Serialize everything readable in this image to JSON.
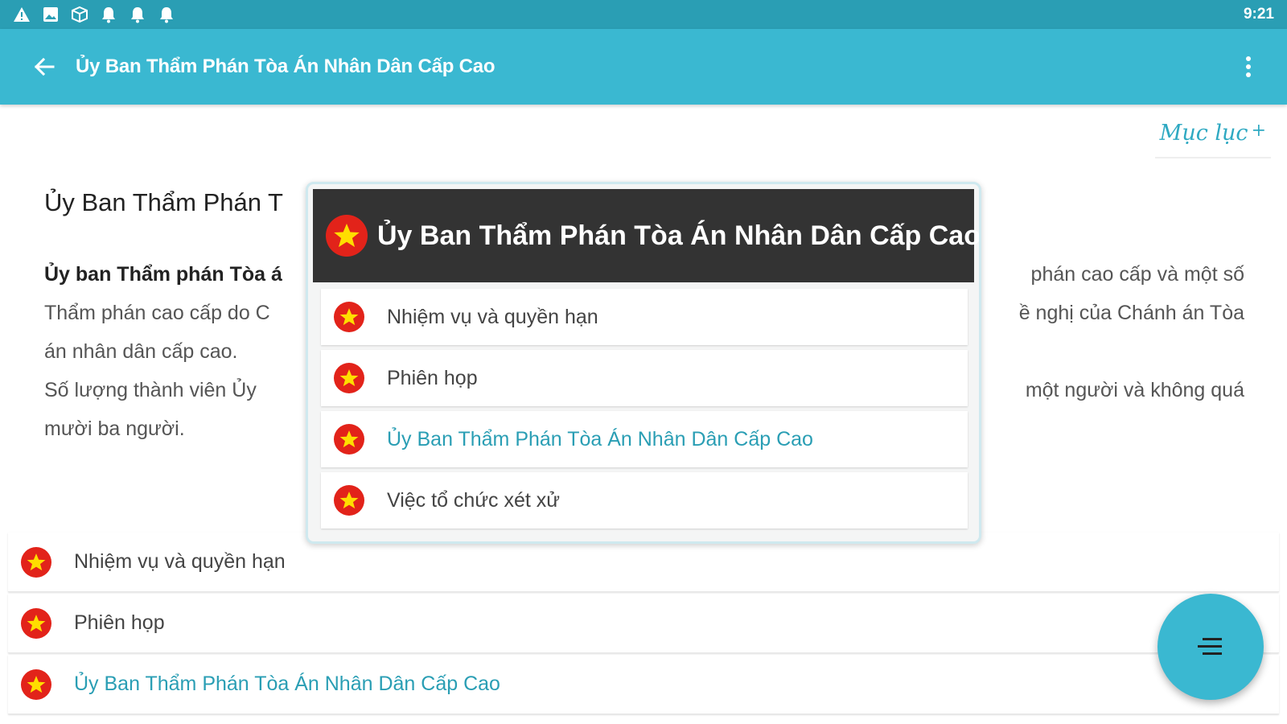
{
  "status_bar": {
    "time": "9:21",
    "icons": [
      "warning-icon",
      "image-icon",
      "box-icon",
      "bell-icon",
      "bell-icon",
      "bell-icon"
    ]
  },
  "app_bar": {
    "title": "Ủy Ban Thẩm Phán Tòa Án Nhân Dân Cấp Cao",
    "back_icon": "arrow-left-icon",
    "menu_icon": "more-vertical-icon"
  },
  "toc_link": {
    "label": "Mục lục"
  },
  "article": {
    "title": "Ủy Ban Thẩm Phán T",
    "line1_bold": "Ủy ban Thẩm phán Tòa á",
    "line1_rest": "phán cao cấp và một số",
    "line2_left": "Thẩm phán cao cấp do C",
    "line2_right": "ề nghị của Chánh án Tòa",
    "line3": "án nhân dân cấp cao.",
    "line4_left": "Số lượng thành viên Ủy",
    "line4_right": "một người và không quá",
    "line5": "mười ba người."
  },
  "bottom_list": [
    {
      "label": "Nhiệm vụ và quyền hạn",
      "active": false
    },
    {
      "label": "Phiên họp",
      "active": false
    },
    {
      "label": "Ủy Ban Thẩm Phán Tòa Án Nhân Dân Cấp Cao",
      "active": true
    }
  ],
  "popup": {
    "title": "Ủy Ban Thẩm Phán Tòa Án Nhân Dân Cấp Cao",
    "items": [
      {
        "label": "Nhiệm vụ và quyền hạn",
        "active": false
      },
      {
        "label": "Phiên họp",
        "active": false
      },
      {
        "label": "Ủy Ban Thẩm Phán Tòa Án Nhân Dân Cấp Cao",
        "active": true
      },
      {
        "label": "Việc tổ chức xét xử",
        "active": false
      }
    ]
  },
  "fab": {
    "icon": "menu-lines-icon"
  },
  "colors": {
    "status_bar": "#2a9eb4",
    "app_bar": "#3ab8d1",
    "accent_text": "#2a9eb4",
    "popup_header": "#333333",
    "badge_red": "#e2231a",
    "badge_star": "#ffde00"
  }
}
